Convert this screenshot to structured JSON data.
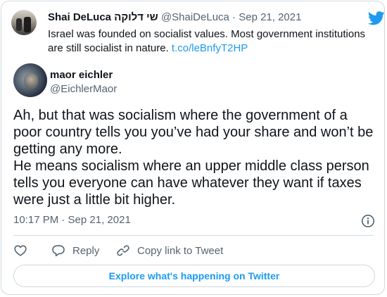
{
  "quoted_tweet": {
    "display_name": "Shai DeLuca שי דלוקה",
    "handle_date": "@ShaiDeLuca · Sep 21, 2021",
    "text": "Israel was founded on socialist values. Most government institutions are still socialist in nature. ",
    "link": "t.co/leBnfyT2HP"
  },
  "tweet": {
    "display_name": "maor eichler",
    "handle": "@EichlerMaor",
    "paragraphs": [
      "Ah, but that was socialism where the government of a poor country tells you you’ve had your share and won’t be getting any more.",
      "He means socialism where an upper middle class person tells you everyone can have whatever they want if taxes were just a little bit higher."
    ],
    "timestamp": "10:17 PM · Sep 21, 2021"
  },
  "actions": {
    "reply_label": "Reply",
    "copy_link_label": "Copy link to Tweet"
  },
  "explore_label": "Explore what's happening on Twitter",
  "icons": {
    "brand": "twitter-bird-icon",
    "info": "info-icon",
    "like": "heart-icon",
    "reply": "speech-bubble-icon",
    "copy_link": "link-icon"
  },
  "colors": {
    "accent": "#1d9bf0",
    "text_primary": "#0f1419",
    "text_secondary": "#536471",
    "border": "#cfd9de"
  }
}
